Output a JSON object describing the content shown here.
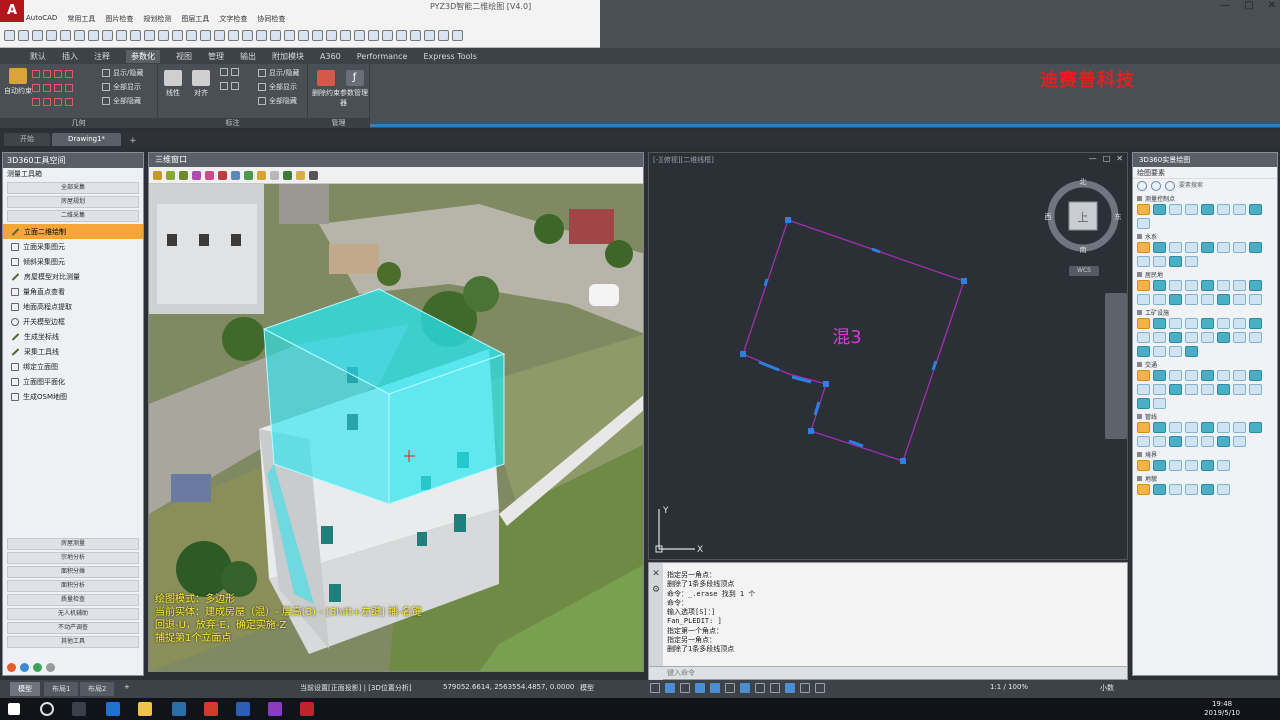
{
  "app": {
    "logo": "A",
    "title": "PYZ3D智能二维绘图 [V4.0]",
    "menus": [
      "AutoCAD",
      "常用工具",
      "图片检查",
      "规划检测",
      "图层工具",
      "文字检查",
      "协同检查"
    ],
    "window_controls": [
      "—",
      "□",
      "✕"
    ]
  },
  "ribbon": {
    "tabs": [
      "默认",
      "插入",
      "注释",
      "参数化",
      "视图",
      "管理",
      "输出",
      "附加模块",
      "A360",
      "Performance",
      "Express Tools"
    ],
    "active_tab": "参数化",
    "panels": [
      {
        "title": "几何",
        "tools": [
          "自动约束",
          "显示/隐藏",
          "全部显示",
          "全部隐藏"
        ]
      },
      {
        "title": "标注",
        "tools": [
          "线性",
          "对齐",
          "显示/隐藏",
          "全部显示",
          "全部隐藏"
        ]
      },
      {
        "title": "管理",
        "tools": [
          "删除约束",
          "参数管理器"
        ]
      }
    ],
    "brand_text": "迪赛普科技"
  },
  "doc_tabs": [
    "开始",
    "Drawing1*"
  ],
  "doc_tab_active": "Drawing1*",
  "left_panel": {
    "title": "3D360工具空间",
    "subtitle": "测量工具箱",
    "top_buttons": [
      "全部采集",
      "房屋规划",
      "二维采集"
    ],
    "items": [
      {
        "label": "立面二维绘制",
        "selected": true
      },
      {
        "label": "立面采集图元",
        "selected": false
      },
      {
        "label": "倾斜采集图元",
        "selected": false
      },
      {
        "label": "房屋模型对比测量",
        "selected": false
      },
      {
        "label": "量角直点查看",
        "selected": false
      },
      {
        "label": "地面高程点提取",
        "selected": false
      },
      {
        "label": "开关模型边框",
        "selected": false
      },
      {
        "label": "生成坐标线",
        "selected": false
      },
      {
        "label": "采集工具线",
        "selected": false
      },
      {
        "label": "绑定立面图",
        "selected": false
      },
      {
        "label": "立面图平面化",
        "selected": false
      },
      {
        "label": "生成OSM地图",
        "selected": false
      }
    ],
    "bottom_buttons": [
      "房屋测量",
      "宗地分析",
      "面积分摊",
      "面积分析",
      "质量检查",
      "无人机辅助",
      "不动产调查",
      "其他工具"
    ]
  },
  "view3d": {
    "title": "三维窗口",
    "overlay_lines": [
      "绘图模式：多边形",
      "当前实体：建成房屋（混）- 层高(3) - [Shift+左键] 捕-名键",
      "回退-U，放弃-E，确定实施-Z",
      "捕捉第1个立面点"
    ]
  },
  "cad": {
    "title": "[-][俯视][二维线框]",
    "controls": [
      "—",
      "□",
      "✕"
    ],
    "label": "混3",
    "viewcube_face": "上",
    "viewcube_wcs": "WCS",
    "compass": [
      "北",
      "南",
      "东",
      "西"
    ],
    "axis_x": "X",
    "axis_y": "Y"
  },
  "command": {
    "lines": [
      "指定另一角点：",
      "删除了1条多段线顶点",
      "命令：_.erase 找到 1 个",
      "命令：",
      "输入选项[S]：]",
      "Fan_PLEDIT: ]",
      "指定第一个角点：",
      "指定另一角点：",
      "删除了1条多段线顶点"
    ],
    "input_placeholder": "键入命令"
  },
  "right_panel": {
    "title": "3D360实景绘图",
    "subtitle": "绘图要素",
    "search_placeholder": "要素搜索",
    "sections": [
      {
        "name": "测量控制点",
        "count": 9
      },
      {
        "name": "水系",
        "count": 12
      },
      {
        "name": "居民地",
        "count": 16
      },
      {
        "name": "工矿设施",
        "count": 20
      },
      {
        "name": "交通",
        "count": 18
      },
      {
        "name": "管线",
        "count": 15
      },
      {
        "name": "境界",
        "count": 6
      },
      {
        "name": "地貌",
        "count": 6
      }
    ]
  },
  "status": {
    "layout_tabs": [
      "模型",
      "布局1",
      "布局2"
    ],
    "active_layout": "模型",
    "left_text": "当前设置[正面投影] | [3D位置分析]",
    "coords": "579052.6614, 2563554.4857, 0.0000",
    "mode": "模型",
    "scale": "1:1 / 100%",
    "units": "小数"
  },
  "taskbar": {
    "time": "19:48",
    "date": "2019/5/10"
  },
  "colors": {
    "accent_orange": "#f6a637",
    "polygon_stroke": "#a22fb0",
    "vertex_blue": "#2d80e0",
    "label_magenta": "#d23bd6",
    "brand_red": "#e0211f",
    "building_cyan": "#27e6f0"
  }
}
